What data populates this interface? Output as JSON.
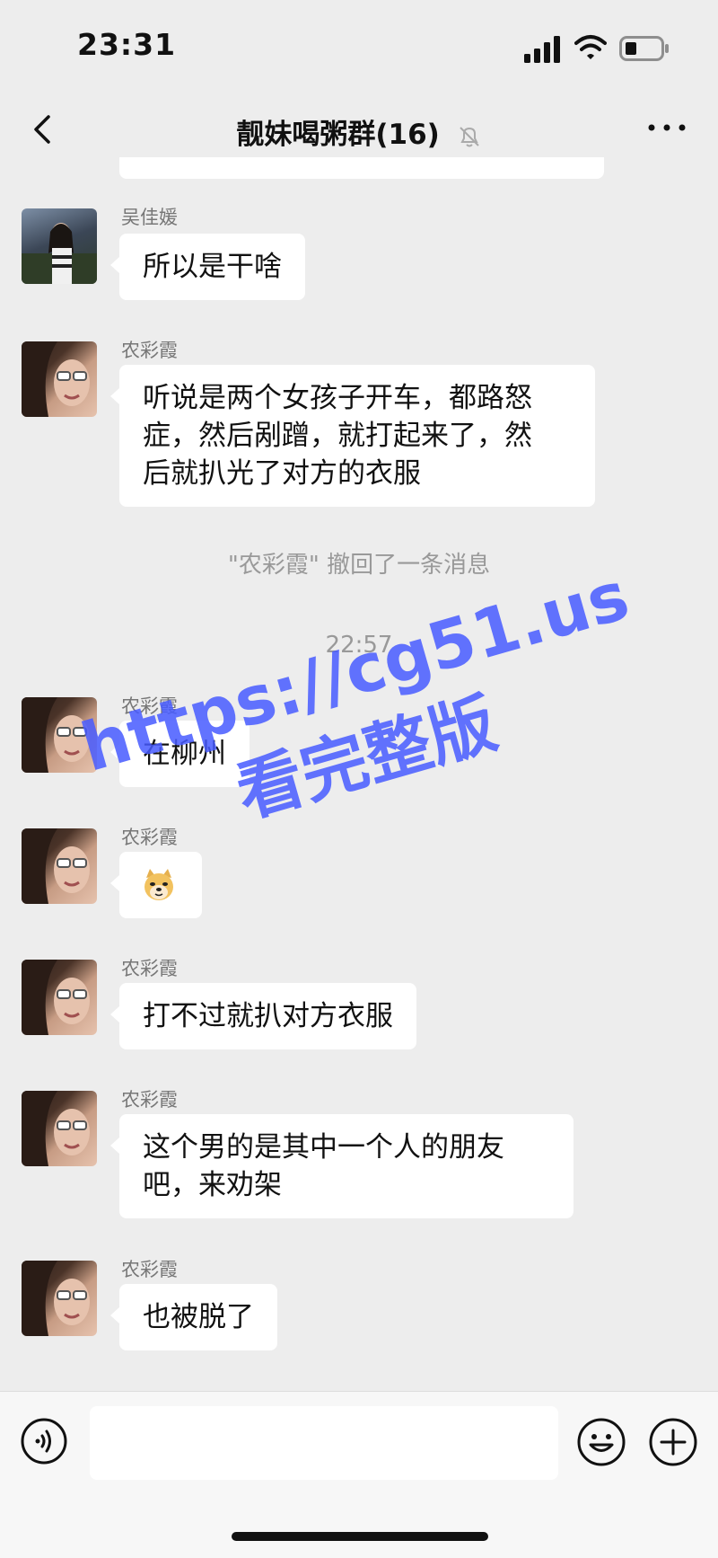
{
  "status_bar": {
    "time": "23:31"
  },
  "header": {
    "title": "靓妹喝粥群(16)"
  },
  "messages": [
    {
      "sender": "吴佳媛",
      "text": "所以是干啥"
    },
    {
      "sender": "农彩霞",
      "lines": [
        "听说是两个女孩子开车，都路怒",
        "症，然后剐蹭，就打起来了，然",
        "后就扒光了对方的衣服"
      ]
    },
    {
      "sender": "农彩霞",
      "text": "在柳州"
    },
    {
      "sender": "农彩霞",
      "emoji": "doge"
    },
    {
      "sender": "农彩霞",
      "text": "打不过就扒对方衣服"
    },
    {
      "sender": "农彩霞",
      "lines": [
        "这个男的是其中一个人的朋友",
        "吧，来劝架"
      ]
    },
    {
      "sender": "农彩霞",
      "text": "也被脱了"
    }
  ],
  "system": {
    "recall": "\"农彩霞\" 撤回了一条消息",
    "timestamp": "22:57"
  },
  "watermark": {
    "url": "https://cg51.us",
    "text": "看完整版"
  },
  "icons": {
    "back": "chevron-left-icon",
    "mute": "bell-slash-icon",
    "more": "more-icon",
    "voice": "voice-icon",
    "emoji": "emoji-icon",
    "plus": "plus-icon"
  }
}
